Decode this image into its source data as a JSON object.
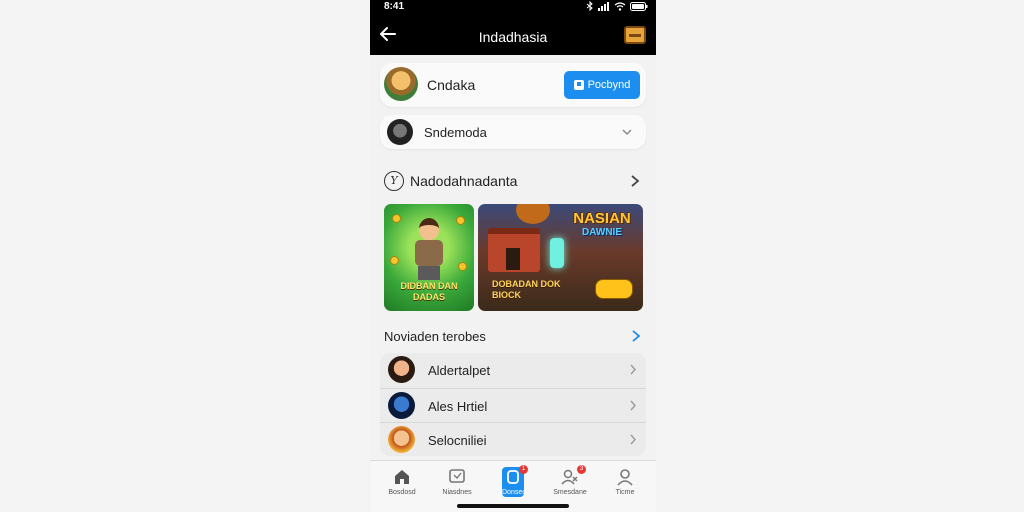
{
  "status_bar": {
    "time": "8:41"
  },
  "app_bar": {
    "title": "Indadhasia"
  },
  "profile_card": {
    "name": "Cndaka",
    "button_label": "Pocbynd"
  },
  "account_select": {
    "name": "Sndemoda"
  },
  "featured": {
    "header": "Nadodahnadanta",
    "games": [
      {
        "caption_line1": "DIDBAN DAN",
        "caption_line2": "DADAS"
      },
      {
        "logo_line1": "NASIAN",
        "logo_line2": "DAWNIE",
        "caption_line1": "DOBADAN DOK",
        "caption_line2": "BIOCK"
      }
    ]
  },
  "friends": {
    "header": "Noviaden terobes",
    "items": [
      {
        "name": "Aldertalpet"
      },
      {
        "name": "Ales Hrtiel"
      },
      {
        "name": "Selocniliei"
      }
    ]
  },
  "tab_bar": {
    "items": [
      {
        "label": "Bosdosd",
        "icon": "home-icon"
      },
      {
        "label": "Niasdnes",
        "icon": "chat-icon"
      },
      {
        "label": "Donseo",
        "icon": "apps-icon",
        "active": true,
        "badge": "1"
      },
      {
        "label": "Smesdane",
        "icon": "friends-icon",
        "badge": "3"
      },
      {
        "label": "Ticme",
        "icon": "profile-icon"
      }
    ]
  },
  "colors": {
    "accent": "#1c8ef0",
    "badge": "#e53935",
    "app_bar": "#000000"
  }
}
